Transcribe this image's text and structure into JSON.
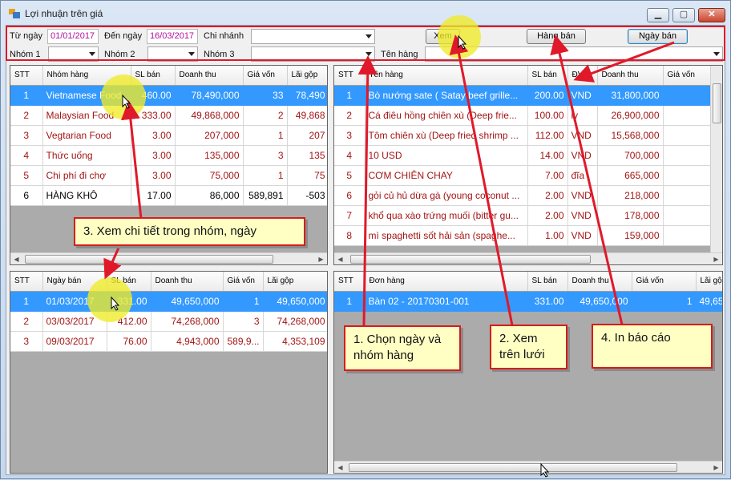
{
  "window": {
    "title": "Lợi nhuận trên giá"
  },
  "filters": {
    "from_date_label": "Từ ngày",
    "from_date": "01/01/2017",
    "to_date_label": "Đến ngày",
    "to_date": "16/03/2017",
    "branch_label": "Chi nhánh",
    "group1_label": "Nhóm 1",
    "group2_label": "Nhóm 2",
    "group3_label": "Nhóm 3",
    "item_name_label": "Tên hàng",
    "view_button": "Xem",
    "items_sold_button": "Hàng bán",
    "sale_date_button": "Ngày bán"
  },
  "group_grid": {
    "headers": [
      "STT",
      "Nhóm hàng",
      "SL bán",
      "Doanh thu",
      "Giá vốn",
      "Lãi gộp"
    ],
    "rows": [
      [
        "1",
        "Vietnamese Food",
        "460.00",
        "78,490,000",
        "33",
        "78,490"
      ],
      [
        "2",
        "Malaysian Food",
        "333.00",
        "49,868,000",
        "2",
        "49,868"
      ],
      [
        "3",
        "Vegtarian Food",
        "3.00",
        "207,000",
        "1",
        "207"
      ],
      [
        "4",
        "Thức uống",
        "3.00",
        "135,000",
        "3",
        "135"
      ],
      [
        "5",
        "Chi phí đi chợ",
        "3.00",
        "75,000",
        "1",
        "75"
      ],
      [
        "6",
        "HÀNG KHÔ",
        "17.00",
        "86,000",
        "589,891",
        "-503"
      ]
    ]
  },
  "item_grid": {
    "headers": [
      "STT",
      "Tên hàng",
      "SL bán",
      "ĐVT",
      "Doanh thu",
      "Giá vốn"
    ],
    "rows": [
      [
        "1",
        "Bò nướng sate ( Satay beef grille...",
        "200.00",
        "VND",
        "31,800,000",
        ""
      ],
      [
        "2",
        "Cá điêu hồng chiên xù (Deep frie...",
        "100.00",
        "ly",
        "26,900,000",
        ""
      ],
      [
        "3",
        "Tôm chiên xù (Deep fried shrimp ...",
        "112.00",
        "VND",
        "15,568,000",
        ""
      ],
      [
        "4",
        "10 USD",
        "14.00",
        "VND",
        "700,000",
        ""
      ],
      [
        "5",
        "CƠM CHIÊN CHAY",
        "7.00",
        "đĩa",
        "665,000",
        ""
      ],
      [
        "6",
        "gỏi củ hủ dừa gà (young coconut ...",
        "2.00",
        "VND",
        "218,000",
        ""
      ],
      [
        "7",
        "khổ qua xào trứng muối (bitter gu...",
        "2.00",
        "VND",
        "178,000",
        ""
      ],
      [
        "8",
        "mì spaghetti sốt hải sản (spaghe...",
        "1.00",
        "VND",
        "159,000",
        ""
      ]
    ]
  },
  "date_grid": {
    "headers": [
      "STT",
      "Ngày bán",
      "SL bán",
      "Doanh thu",
      "Giá vốn",
      "Lãi gộp"
    ],
    "rows": [
      [
        "1",
        "01/03/2017",
        "331.00",
        "49,650,000",
        "1",
        "49,650,000"
      ],
      [
        "2",
        "03/03/2017",
        "412.00",
        "74,268,000",
        "3",
        "74,268,000"
      ],
      [
        "3",
        "09/03/2017",
        "76.00",
        "4,943,000",
        "589,9...",
        "4,353,109"
      ]
    ]
  },
  "invoice_grid": {
    "headers": [
      "STT",
      "Đơn hàng",
      "SL bán",
      "Doanh thu",
      "Giá vốn",
      "Lãi gộ"
    ],
    "rows": [
      [
        "1",
        "Bàn 02 - 20170301-001",
        "331.00",
        "49,650,000",
        "1",
        "49,65"
      ]
    ]
  },
  "callouts": {
    "step1": "1. Chọn ngày và nhóm hàng",
    "step2": "2. Xem trên lưới",
    "step3": "3. Xem chi tiết trong nhóm, ngày",
    "step4": "4. In báo cáo"
  },
  "colors": {
    "accent_red": "#e0192a",
    "selection": "#3399ff",
    "callout_bg": "#ffffc4",
    "date_text": "#b00ea0",
    "row_text": "#a31515"
  }
}
